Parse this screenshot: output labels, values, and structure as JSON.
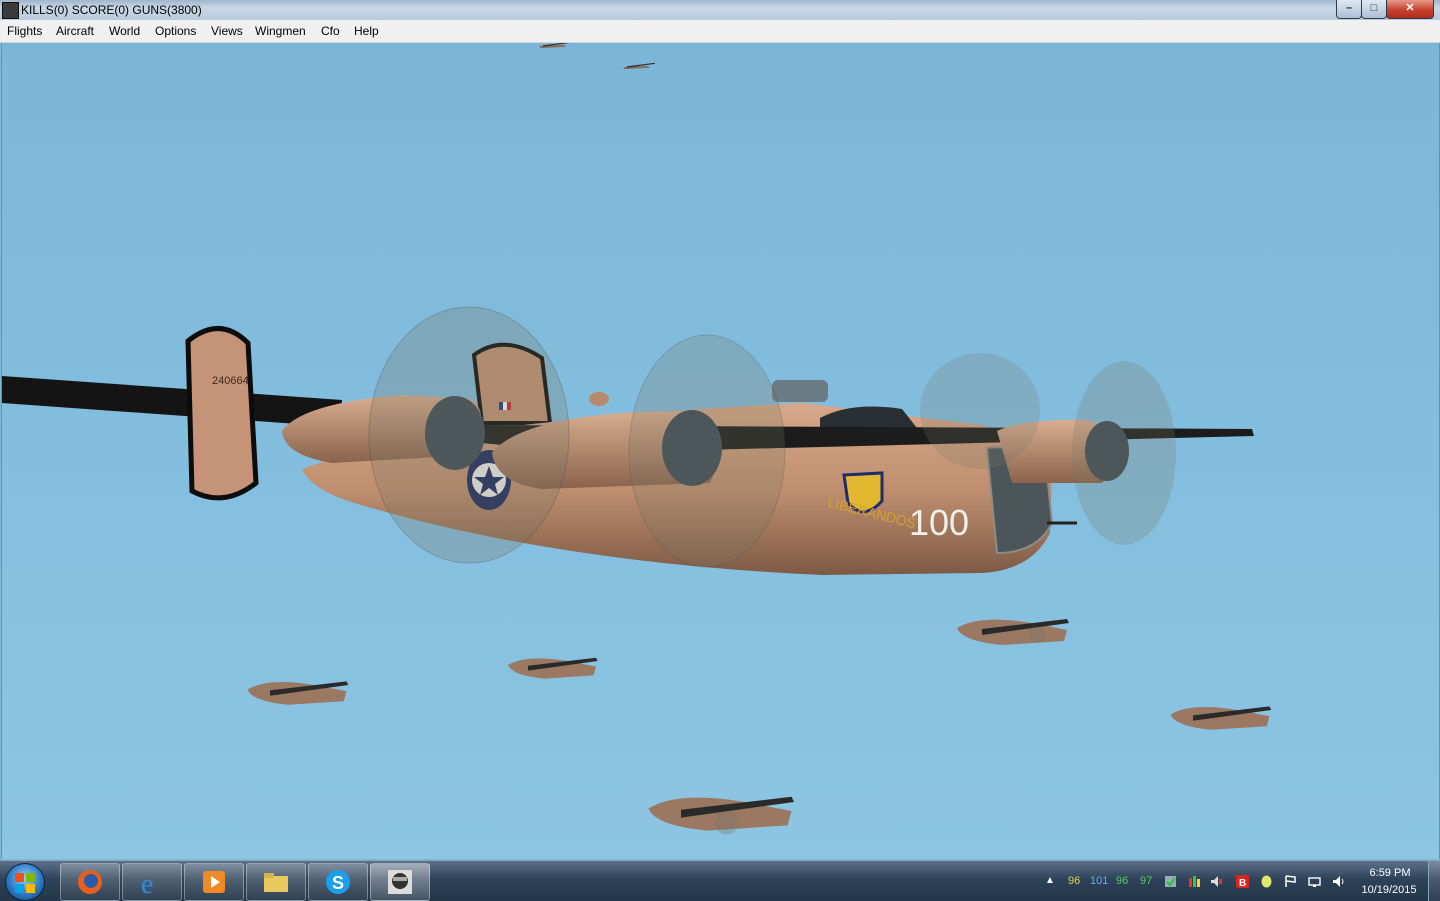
{
  "window": {
    "title": "KILLS(0) SCORE(0) GUNS(3800)",
    "controls": {
      "minimize": "–",
      "maximize": "□",
      "close": "✕"
    }
  },
  "menu": {
    "items": [
      "Flights",
      "Aircraft",
      "World",
      "Options",
      "Views",
      "Wingmen",
      "Cfo",
      "Help"
    ]
  },
  "scene": {
    "aircraft": {
      "serial": "240664",
      "nose_art": "LIBERANDOS",
      "number": "100"
    },
    "colors": {
      "sky": "#7fb8d9",
      "fuselage": "#c08f70",
      "wing": "#1c1c1c"
    }
  },
  "taskbar": {
    "apps": [
      "Firefox",
      "Internet Explorer",
      "Media Player",
      "Windows Explorer",
      "Skype",
      "Pilot game"
    ],
    "tray": {
      "readouts": [
        "96",
        "101",
        "96",
        "97"
      ],
      "readout_colors": [
        "#e8d23a",
        "#4fb7ff",
        "#55d155",
        "#55d155"
      ]
    },
    "clock": {
      "time": "6:59 PM",
      "date": "10/19/2015"
    }
  }
}
